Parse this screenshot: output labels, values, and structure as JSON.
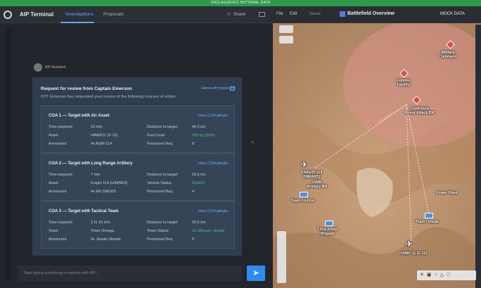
{
  "banner": "UNCLASSIFIED NOTIONAL DATA",
  "app": {
    "title": "AIP Terminal"
  },
  "tabs": [
    {
      "label": "Investigations",
      "active": true
    },
    {
      "label": "Proposals",
      "active": false
    }
  ],
  "header": {
    "share_label": "Share"
  },
  "assistant": {
    "label": "AIP Assistant"
  },
  "request": {
    "title": "Request for review from Captain Emerson",
    "subtitle": "CPT Emerson has requested your review of the following courses of action:",
    "handoff_label": "Hand-off Inspector",
    "coas": [
      {
        "title": "COA 1 — Target with Air Asset",
        "link": "View COA details",
        "fields": [
          {
            "k": "Time required",
            "v": "16 min"
          },
          {
            "k": "Distance to target",
            "v": "40.3 km"
          },
          {
            "k": "Asset",
            "v": "HAWK11 (F-16)"
          },
          {
            "k": "Fuel Level",
            "v": "935 kg (80%)",
            "green": true
          },
          {
            "k": "Armament",
            "v": "4x AGM-114"
          },
          {
            "k": "Personnel Req",
            "v": "8"
          }
        ]
      },
      {
        "title": "COA 2 — Target with Long Range Artillery",
        "link": "View COA details",
        "fields": [
          {
            "k": "Time required",
            "v": "7 min"
          },
          {
            "k": "Distance to target",
            "v": "53.5 km"
          },
          {
            "k": "Asset",
            "v": "Knight 114 (HIMARS)"
          },
          {
            "k": "Vehicle Status",
            "v": "READY",
            "green": true
          },
          {
            "k": "Armament",
            "v": "4x ER GMLRS"
          },
          {
            "k": "Personnel Req",
            "v": "4"
          }
        ]
      },
      {
        "title": "COA 3 — Target with Tactical Team",
        "link": "View COA details",
        "fields": [
          {
            "k": "Time required",
            "v": "2 hr 15 min"
          },
          {
            "k": "Distance to target",
            "v": "39.5 km"
          },
          {
            "k": "Team",
            "v": "Team Omega"
          },
          {
            "k": "Team Status",
            "v": "On Mission, Ready",
            "green": true
          },
          {
            "k": "Armament",
            "v": "6x Javelin Missile"
          },
          {
            "k": "Personnel Req",
            "v": "9"
          }
        ]
      }
    ]
  },
  "input": {
    "placeholder": "Start typing something to explore with AIP..."
  },
  "map": {
    "menu": [
      "File",
      "Edit"
    ],
    "saved_label": "Saved",
    "title": "Battlefield Overview",
    "mock_label": "MOCK DATA",
    "labels": {
      "military_command": "Military\nCommand",
      "comms_facility": "Comms\nFacility",
      "confirmed_armor": "Confirmed\nArmor Attack BN",
      "knight": "KNIGHT 114\n(HIMARS)",
      "artillery": "15MN\nArtillery BN",
      "team_foxtrot": "Team Foxtrot",
      "power_plant": "Power Plant",
      "team_omega": "Team Omega",
      "armor_brigade": "T2nd Armor\nBrigade",
      "hawk": "HAWK 11 (F-16)"
    },
    "colors": {
      "threat": "#e54848",
      "friendly": "#4c8fe8",
      "accent": "#2f8df0"
    }
  }
}
